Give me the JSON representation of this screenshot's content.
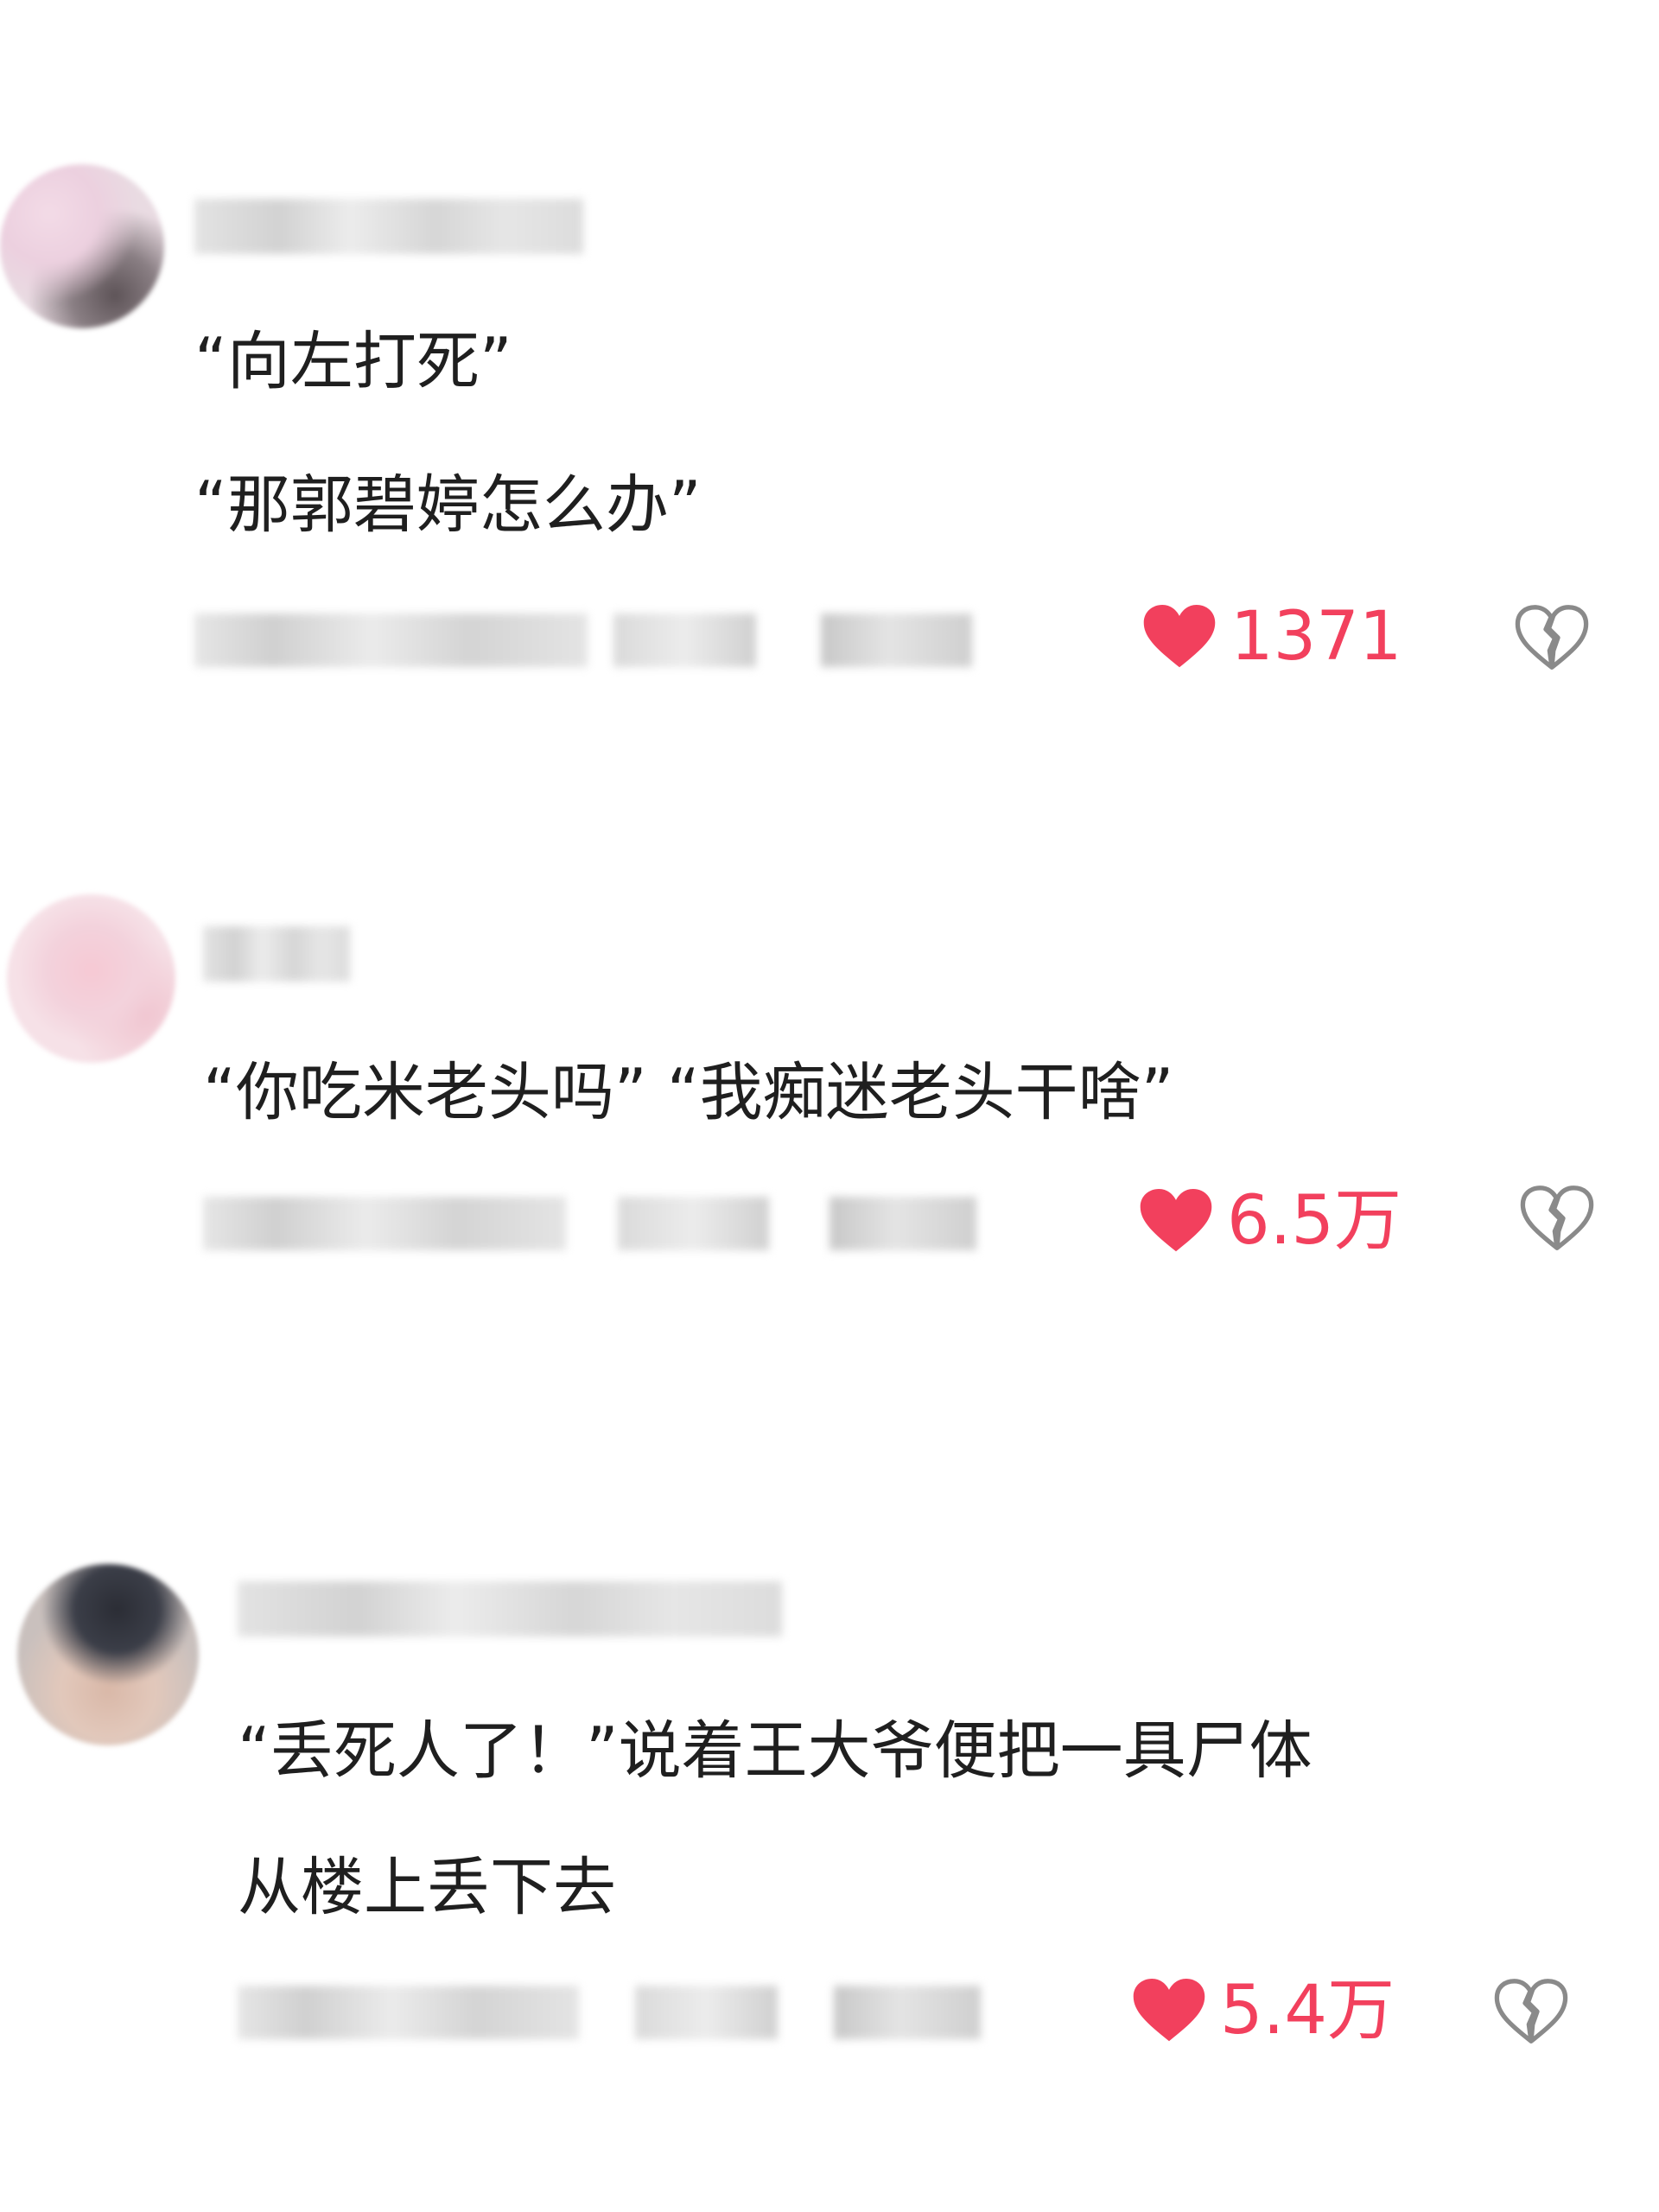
{
  "comments": [
    {
      "lines": [
        "“向左打死”",
        "“那郭碧婷怎么办”"
      ],
      "likes": "1371"
    },
    {
      "lines": [
        "“你吃米老头吗” “我痴迷老头干啥”"
      ],
      "likes": "6.5万"
    },
    {
      "lines": [
        "“丢死人了！”说着王大爷便把一具尸体",
        "从楼上丢下去"
      ],
      "likes": "5.4万"
    }
  ],
  "icons": {
    "like": "heart-icon",
    "dislike": "broken-heart-icon"
  },
  "colors": {
    "like_red": "#f2405d",
    "dislike_gray": "#8a8a8a",
    "text": "#1f1f1f"
  }
}
